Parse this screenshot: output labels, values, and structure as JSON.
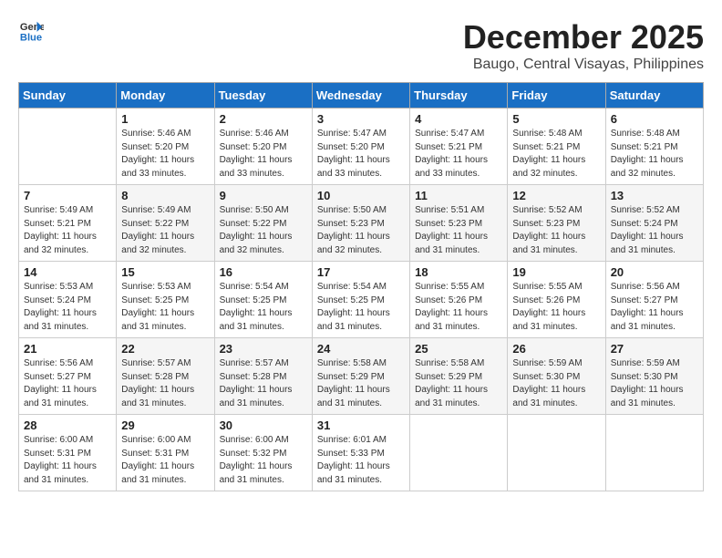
{
  "header": {
    "logo_general": "General",
    "logo_blue": "Blue",
    "month_title": "December 2025",
    "location": "Baugo, Central Visayas, Philippines"
  },
  "weekdays": [
    "Sunday",
    "Monday",
    "Tuesday",
    "Wednesday",
    "Thursday",
    "Friday",
    "Saturday"
  ],
  "weeks": [
    [
      {
        "day": "",
        "info": ""
      },
      {
        "day": "1",
        "info": "Sunrise: 5:46 AM\nSunset: 5:20 PM\nDaylight: 11 hours\nand 33 minutes."
      },
      {
        "day": "2",
        "info": "Sunrise: 5:46 AM\nSunset: 5:20 PM\nDaylight: 11 hours\nand 33 minutes."
      },
      {
        "day": "3",
        "info": "Sunrise: 5:47 AM\nSunset: 5:20 PM\nDaylight: 11 hours\nand 33 minutes."
      },
      {
        "day": "4",
        "info": "Sunrise: 5:47 AM\nSunset: 5:21 PM\nDaylight: 11 hours\nand 33 minutes."
      },
      {
        "day": "5",
        "info": "Sunrise: 5:48 AM\nSunset: 5:21 PM\nDaylight: 11 hours\nand 32 minutes."
      },
      {
        "day": "6",
        "info": "Sunrise: 5:48 AM\nSunset: 5:21 PM\nDaylight: 11 hours\nand 32 minutes."
      }
    ],
    [
      {
        "day": "7",
        "info": "Sunrise: 5:49 AM\nSunset: 5:21 PM\nDaylight: 11 hours\nand 32 minutes."
      },
      {
        "day": "8",
        "info": "Sunrise: 5:49 AM\nSunset: 5:22 PM\nDaylight: 11 hours\nand 32 minutes."
      },
      {
        "day": "9",
        "info": "Sunrise: 5:50 AM\nSunset: 5:22 PM\nDaylight: 11 hours\nand 32 minutes."
      },
      {
        "day": "10",
        "info": "Sunrise: 5:50 AM\nSunset: 5:23 PM\nDaylight: 11 hours\nand 32 minutes."
      },
      {
        "day": "11",
        "info": "Sunrise: 5:51 AM\nSunset: 5:23 PM\nDaylight: 11 hours\nand 31 minutes."
      },
      {
        "day": "12",
        "info": "Sunrise: 5:52 AM\nSunset: 5:23 PM\nDaylight: 11 hours\nand 31 minutes."
      },
      {
        "day": "13",
        "info": "Sunrise: 5:52 AM\nSunset: 5:24 PM\nDaylight: 11 hours\nand 31 minutes."
      }
    ],
    [
      {
        "day": "14",
        "info": "Sunrise: 5:53 AM\nSunset: 5:24 PM\nDaylight: 11 hours\nand 31 minutes."
      },
      {
        "day": "15",
        "info": "Sunrise: 5:53 AM\nSunset: 5:25 PM\nDaylight: 11 hours\nand 31 minutes."
      },
      {
        "day": "16",
        "info": "Sunrise: 5:54 AM\nSunset: 5:25 PM\nDaylight: 11 hours\nand 31 minutes."
      },
      {
        "day": "17",
        "info": "Sunrise: 5:54 AM\nSunset: 5:25 PM\nDaylight: 11 hours\nand 31 minutes."
      },
      {
        "day": "18",
        "info": "Sunrise: 5:55 AM\nSunset: 5:26 PM\nDaylight: 11 hours\nand 31 minutes."
      },
      {
        "day": "19",
        "info": "Sunrise: 5:55 AM\nSunset: 5:26 PM\nDaylight: 11 hours\nand 31 minutes."
      },
      {
        "day": "20",
        "info": "Sunrise: 5:56 AM\nSunset: 5:27 PM\nDaylight: 11 hours\nand 31 minutes."
      }
    ],
    [
      {
        "day": "21",
        "info": "Sunrise: 5:56 AM\nSunset: 5:27 PM\nDaylight: 11 hours\nand 31 minutes."
      },
      {
        "day": "22",
        "info": "Sunrise: 5:57 AM\nSunset: 5:28 PM\nDaylight: 11 hours\nand 31 minutes."
      },
      {
        "day": "23",
        "info": "Sunrise: 5:57 AM\nSunset: 5:28 PM\nDaylight: 11 hours\nand 31 minutes."
      },
      {
        "day": "24",
        "info": "Sunrise: 5:58 AM\nSunset: 5:29 PM\nDaylight: 11 hours\nand 31 minutes."
      },
      {
        "day": "25",
        "info": "Sunrise: 5:58 AM\nSunset: 5:29 PM\nDaylight: 11 hours\nand 31 minutes."
      },
      {
        "day": "26",
        "info": "Sunrise: 5:59 AM\nSunset: 5:30 PM\nDaylight: 11 hours\nand 31 minutes."
      },
      {
        "day": "27",
        "info": "Sunrise: 5:59 AM\nSunset: 5:30 PM\nDaylight: 11 hours\nand 31 minutes."
      }
    ],
    [
      {
        "day": "28",
        "info": "Sunrise: 6:00 AM\nSunset: 5:31 PM\nDaylight: 11 hours\nand 31 minutes."
      },
      {
        "day": "29",
        "info": "Sunrise: 6:00 AM\nSunset: 5:31 PM\nDaylight: 11 hours\nand 31 minutes."
      },
      {
        "day": "30",
        "info": "Sunrise: 6:00 AM\nSunset: 5:32 PM\nDaylight: 11 hours\nand 31 minutes."
      },
      {
        "day": "31",
        "info": "Sunrise: 6:01 AM\nSunset: 5:33 PM\nDaylight: 11 hours\nand 31 minutes."
      },
      {
        "day": "",
        "info": ""
      },
      {
        "day": "",
        "info": ""
      },
      {
        "day": "",
        "info": ""
      }
    ]
  ]
}
